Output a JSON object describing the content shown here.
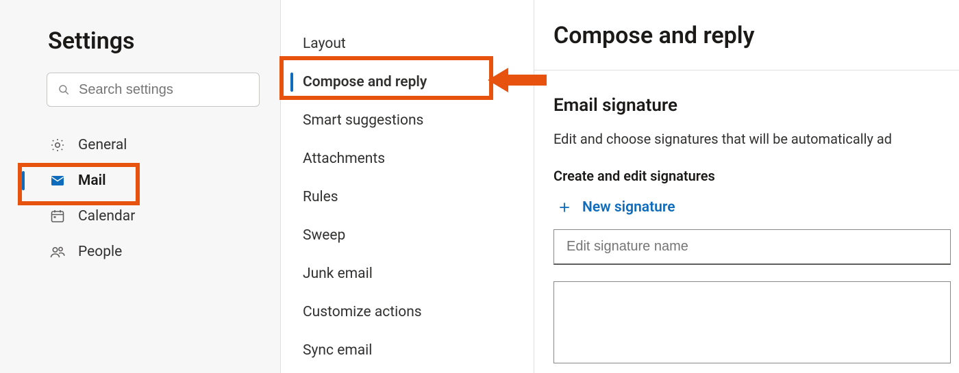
{
  "left": {
    "title": "Settings",
    "search_placeholder": "Search settings",
    "categories": [
      {
        "key": "general",
        "label": "General",
        "icon": "gear-icon",
        "selected": false
      },
      {
        "key": "mail",
        "label": "Mail",
        "icon": "mail-icon",
        "selected": true
      },
      {
        "key": "calendar",
        "label": "Calendar",
        "icon": "calendar-icon",
        "selected": false
      },
      {
        "key": "people",
        "label": "People",
        "icon": "people-icon",
        "selected": false
      }
    ]
  },
  "middle": {
    "items": [
      {
        "label": "Layout",
        "selected": false
      },
      {
        "label": "Compose and reply",
        "selected": true
      },
      {
        "label": "Smart suggestions",
        "selected": false
      },
      {
        "label": "Attachments",
        "selected": false
      },
      {
        "label": "Rules",
        "selected": false
      },
      {
        "label": "Sweep",
        "selected": false
      },
      {
        "label": "Junk email",
        "selected": false
      },
      {
        "label": "Customize actions",
        "selected": false
      },
      {
        "label": "Sync email",
        "selected": false
      }
    ]
  },
  "right": {
    "page_title": "Compose and reply",
    "section_title": "Email signature",
    "section_desc": "Edit and choose signatures that will be automatically ad",
    "sub_section_title": "Create and edit signatures",
    "new_signature_label": "New signature",
    "signature_name_placeholder": "Edit signature name"
  },
  "annotations": {
    "highlight_color": "#e8520f"
  }
}
